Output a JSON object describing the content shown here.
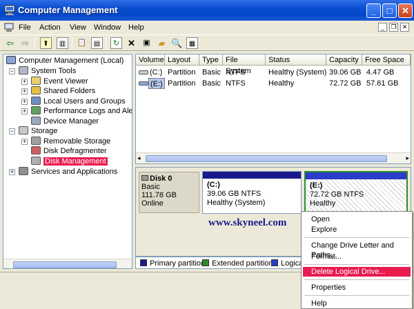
{
  "window": {
    "title": "Computer Management"
  },
  "menu": [
    "File",
    "Action",
    "View",
    "Window",
    "Help"
  ],
  "toolbar_icons": [
    "back-icon",
    "forward-icon",
    "up-icon",
    "show-hide-tree-icon",
    "properties-icon",
    "help-icon",
    "refresh-icon",
    "delete-icon",
    "connect-icon",
    "open-icon",
    "search-icon",
    "magnify-icon"
  ],
  "tree": {
    "root": "Computer Management (Local)",
    "system_tools": "System Tools",
    "event_viewer": "Event Viewer",
    "shared_folders": "Shared Folders",
    "local_users": "Local Users and Groups",
    "perf_logs": "Performance Logs and Alerts",
    "device_manager": "Device Manager",
    "storage": "Storage",
    "removable": "Removable Storage",
    "defrag": "Disk Defragmenter",
    "disk_mgmt": "Disk Management",
    "services": "Services and Applications"
  },
  "volumes": {
    "columns": [
      "Volume",
      "Layout",
      "Type",
      "File System",
      "Status",
      "Capacity",
      "Free Space"
    ],
    "rows": [
      [
        "(C:)",
        "Partition",
        "Basic",
        "NTFS",
        "Healthy (System)",
        "39.06 GB",
        "4.47 GB"
      ],
      [
        "(E:)",
        "Partition",
        "Basic",
        "NTFS",
        "Healthy",
        "72.72 GB",
        "57.61 GB"
      ]
    ]
  },
  "disk": {
    "name": "Disk 0",
    "type": "Basic",
    "size": "111.78 GB",
    "state": "Online",
    "partitions": [
      {
        "label": "(C:)",
        "size": "39.06 GB NTFS",
        "status": "Healthy (System)"
      },
      {
        "label": "(E:)",
        "size": "72.72 GB NTFS",
        "status": "Healthy"
      }
    ]
  },
  "legend": [
    {
      "label": "Primary partition",
      "color": "#1a1a8c"
    },
    {
      "label": "Extended partition",
      "color": "#2e8b2e"
    },
    {
      "label": "Logica",
      "color": "#2a3cc8"
    }
  ],
  "watermark": "www.skyneel.com",
  "context_menu": {
    "open": "Open",
    "explore": "Explore",
    "change_letter": "Change Drive Letter and Paths...",
    "format": "Format...",
    "delete": "Delete Logical Drive...",
    "properties": "Properties",
    "help": "Help"
  },
  "colors": {
    "title_blue": "#0a4ed0",
    "highlight": "#e81c4f",
    "primary": "#1a1a8c",
    "extended": "#2e8b2e"
  }
}
